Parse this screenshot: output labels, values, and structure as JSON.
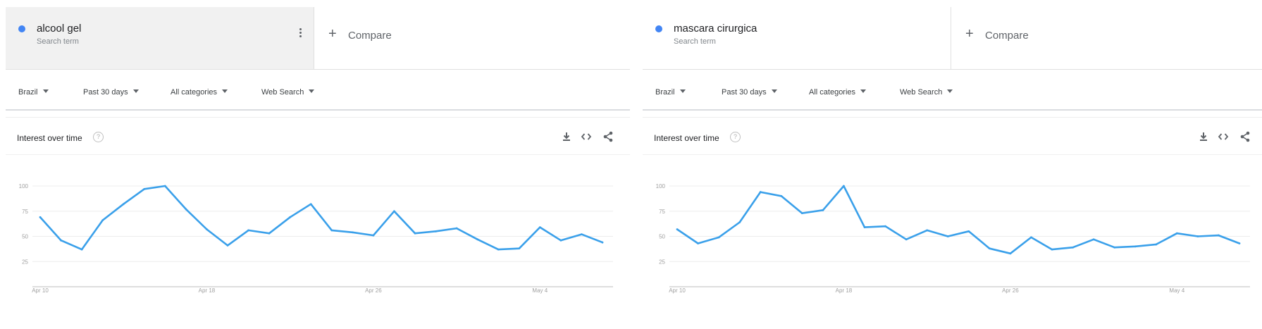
{
  "panels": [
    {
      "term": {
        "name": "alcool gel",
        "sub": "Search term"
      },
      "compare_label": "Compare",
      "filters": [
        "Brazil",
        "Past 30 days",
        "All categories",
        "Web Search"
      ],
      "card_title": "Interest over time",
      "help_glyph": "?"
    },
    {
      "term": {
        "name": "mascara cirurgica",
        "sub": "Search term"
      },
      "compare_label": "Compare",
      "filters": [
        "Brazil",
        "Past 30 days",
        "All categories",
        "Web Search"
      ],
      "card_title": "Interest over time",
      "help_glyph": "?"
    }
  ],
  "series_color": "#3aa0ea",
  "icons": [
    "more-vert-icon",
    "plus-icon",
    "dropdown-caret-icon",
    "help-icon",
    "download-icon",
    "embed-icon",
    "share-icon"
  ],
  "chart_data": [
    {
      "type": "line",
      "title": "Interest over time",
      "x": [
        "Apr 10",
        "Apr 11",
        "Apr 12",
        "Apr 13",
        "Apr 14",
        "Apr 15",
        "Apr 16",
        "Apr 17",
        "Apr 18",
        "Apr 19",
        "Apr 20",
        "Apr 21",
        "Apr 22",
        "Apr 23",
        "Apr 24",
        "Apr 25",
        "Apr 26",
        "Apr 27",
        "Apr 28",
        "Apr 29",
        "Apr 30",
        "May 1",
        "May 2",
        "May 3",
        "May 4",
        "May 5",
        "May 6",
        "May 7"
      ],
      "x_ticks": [
        "Apr 10",
        "Apr 18",
        "Apr 26",
        "May 4"
      ],
      "y_ticks": [
        25,
        50,
        75,
        100
      ],
      "ylim": [
        0,
        100
      ],
      "grid": true,
      "series": [
        {
          "values": [
            69,
            46,
            37,
            66,
            82,
            97,
            100,
            77,
            57,
            41,
            56,
            53,
            69,
            82,
            56,
            54,
            51,
            75,
            53,
            55,
            58,
            47,
            37,
            38,
            59,
            46,
            52,
            44
          ]
        }
      ]
    },
    {
      "type": "line",
      "title": "Interest over time",
      "x": [
        "Apr 10",
        "Apr 11",
        "Apr 12",
        "Apr 13",
        "Apr 14",
        "Apr 15",
        "Apr 16",
        "Apr 17",
        "Apr 18",
        "Apr 19",
        "Apr 20",
        "Apr 21",
        "Apr 22",
        "Apr 23",
        "Apr 24",
        "Apr 25",
        "Apr 26",
        "Apr 27",
        "Apr 28",
        "Apr 29",
        "Apr 30",
        "May 1",
        "May 2",
        "May 3",
        "May 4",
        "May 5",
        "May 6",
        "May 7"
      ],
      "x_ticks": [
        "Apr 10",
        "Apr 18",
        "Apr 26",
        "May 4"
      ],
      "y_ticks": [
        25,
        50,
        75,
        100
      ],
      "ylim": [
        0,
        100
      ],
      "grid": true,
      "series": [
        {
          "values": [
            57,
            43,
            49,
            64,
            94,
            90,
            73,
            76,
            100,
            59,
            60,
            47,
            56,
            50,
            55,
            38,
            33,
            49,
            37,
            39,
            47,
            39,
            40,
            42,
            53,
            50,
            51,
            43
          ]
        }
      ]
    }
  ]
}
